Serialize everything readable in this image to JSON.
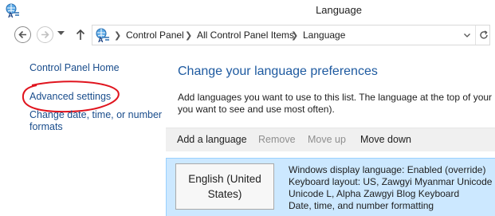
{
  "window": {
    "title": "Language"
  },
  "address": {
    "crumbs": [
      "Control Panel",
      "All Control Panel Items",
      "Language"
    ]
  },
  "sidebar": {
    "items": [
      {
        "label": "Control Panel Home"
      },
      {
        "label": "Advanced settings"
      },
      {
        "label_line1": "Change date, time, or number",
        "label_line2": "formats"
      }
    ]
  },
  "main": {
    "heading": "Change your language preferences",
    "description_line1": "Add languages you want to use to this list. The language at the top of your l",
    "description_line2": "you want to see and use most often).",
    "toolbar": {
      "add": "Add a language",
      "remove": "Remove",
      "move_up": "Move up",
      "move_down": "Move down"
    },
    "languages": [
      {
        "name_line1": "English (United",
        "name_line2": "States)",
        "details": [
          "Windows display language: Enabled (override)",
          "Keyboard layout: US, Zawgyi Myanmar Unicode L",
          "Unicode L, Alpha Zawgyi Blog Keyboard",
          "Date, time, and number formatting"
        ]
      }
    ]
  },
  "colors": {
    "link": "#1a4d8c",
    "heading": "#1e5aa0",
    "selection_bg": "#cce8ff",
    "annotation": "#e0141e"
  }
}
